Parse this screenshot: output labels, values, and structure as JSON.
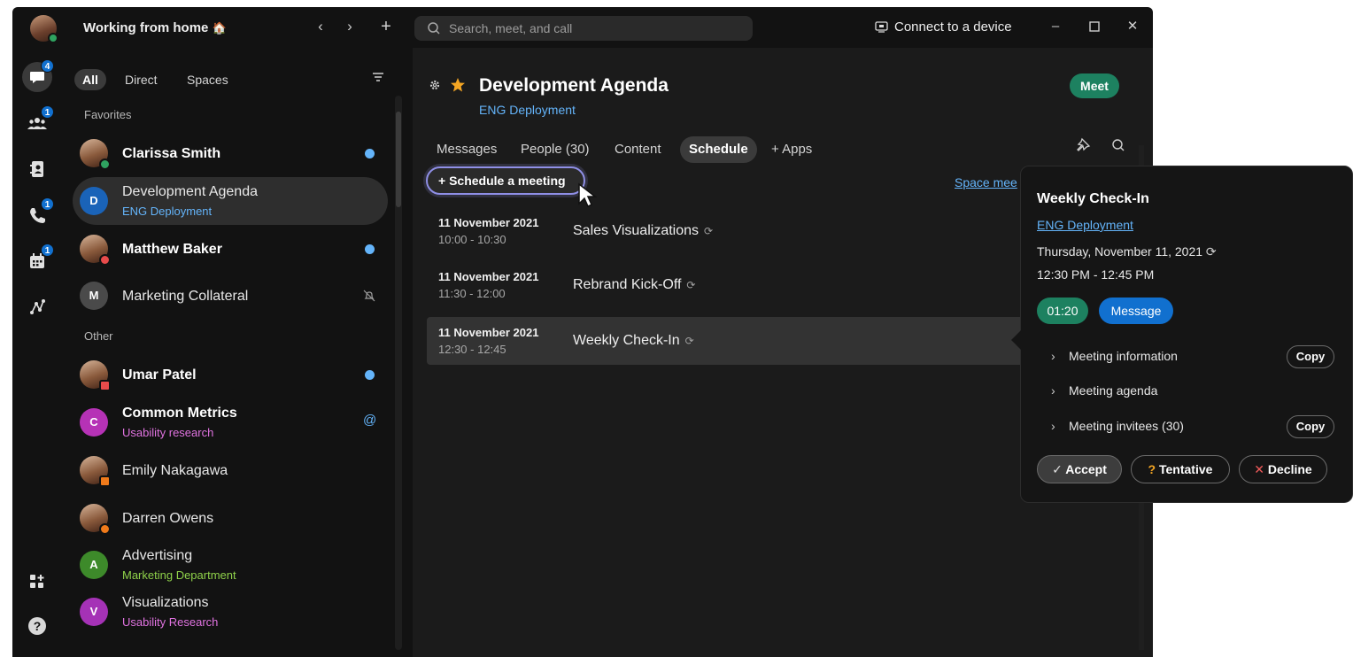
{
  "header": {
    "status_text": "Working from home",
    "status_emoji": "🏠",
    "search_placeholder": "Search, meet, and call",
    "connect_label": "Connect to a device"
  },
  "rail": {
    "messages_badge": "4",
    "teams_badge": "1",
    "calls_badge": "1",
    "meetings_badge": "1"
  },
  "filters": [
    "All",
    "Direct",
    "Spaces"
  ],
  "sections": {
    "favorites": "Favorites",
    "other": "Other"
  },
  "spaces": [
    {
      "title": "Clarissa Smith",
      "subtitle": "",
      "avatar": "",
      "bold": true,
      "unread": true
    },
    {
      "title": "Development Agenda",
      "subtitle": "ENG Deployment",
      "avatar": "D",
      "bold": false,
      "unread": false
    },
    {
      "title": "Matthew Baker",
      "subtitle": "",
      "avatar": "",
      "bold": true,
      "unread": true
    },
    {
      "title": "Marketing Collateral",
      "subtitle": "",
      "avatar": "M",
      "bold": false,
      "unread": false
    },
    {
      "title": "Umar Patel",
      "subtitle": "",
      "avatar": "",
      "bold": true,
      "unread": true
    },
    {
      "title": "Common Metrics",
      "subtitle": "Usability research",
      "avatar": "C",
      "bold": true,
      "unread": false
    },
    {
      "title": "Emily Nakagawa",
      "subtitle": "",
      "avatar": "",
      "bold": false,
      "unread": false
    },
    {
      "title": "Darren Owens",
      "subtitle": "",
      "avatar": "",
      "bold": false,
      "unread": false
    },
    {
      "title": "Advertising",
      "subtitle": "Marketing Department",
      "avatar": "A",
      "bold": false,
      "unread": false
    },
    {
      "title": "Visualizations",
      "subtitle": "Usability Research",
      "avatar": "V",
      "bold": false,
      "unread": false
    }
  ],
  "colors": {
    "presence_active": "#2fa360",
    "presence_dnd": "#e84b4b",
    "presence_call": "#f07a1a",
    "avatar_d": "#1a63b8",
    "avatar_m": "#4a4a4a",
    "avatar_c": "#b632b6",
    "avatar_a": "#3d8a2a",
    "avatar_v": "#a532b6",
    "sub_blue": "#64b4fa",
    "sub_pink": "#e073e0",
    "sub_green": "#8fd14a"
  },
  "space": {
    "title": "Development Agenda",
    "team": "ENG Deployment",
    "meet_label": "Meet",
    "tabs": [
      "Messages",
      "People (30)",
      "Content",
      "Schedule",
      "+ Apps"
    ],
    "schedule_button": "+ Schedule a meeting",
    "space_link": "Space mee"
  },
  "meetings": [
    {
      "date": "11 November 2021",
      "time": "10:00 - 10:30",
      "title": "Sales Visualizations"
    },
    {
      "date": "11 November 2021",
      "time": "11:30 - 12:00",
      "title": "Rebrand Kick-Off"
    },
    {
      "date": "11 November 2021",
      "time": "12:30 - 12:45",
      "title": "Weekly Check-In"
    }
  ],
  "popover": {
    "title": "Weekly Check-In",
    "team_link": "ENG Deployment",
    "date": "Thursday, November 11, 2021",
    "time": "12:30 PM - 12:45 PM",
    "timer": "01:20",
    "message_label": "Message",
    "sections": [
      {
        "label": "Meeting information",
        "copy": "Copy"
      },
      {
        "label": "Meeting agenda",
        "copy": ""
      },
      {
        "label": "Meeting invitees (30)",
        "copy": "Copy"
      }
    ],
    "accept": "Accept",
    "tentative": "Tentative",
    "decline": "Decline"
  }
}
